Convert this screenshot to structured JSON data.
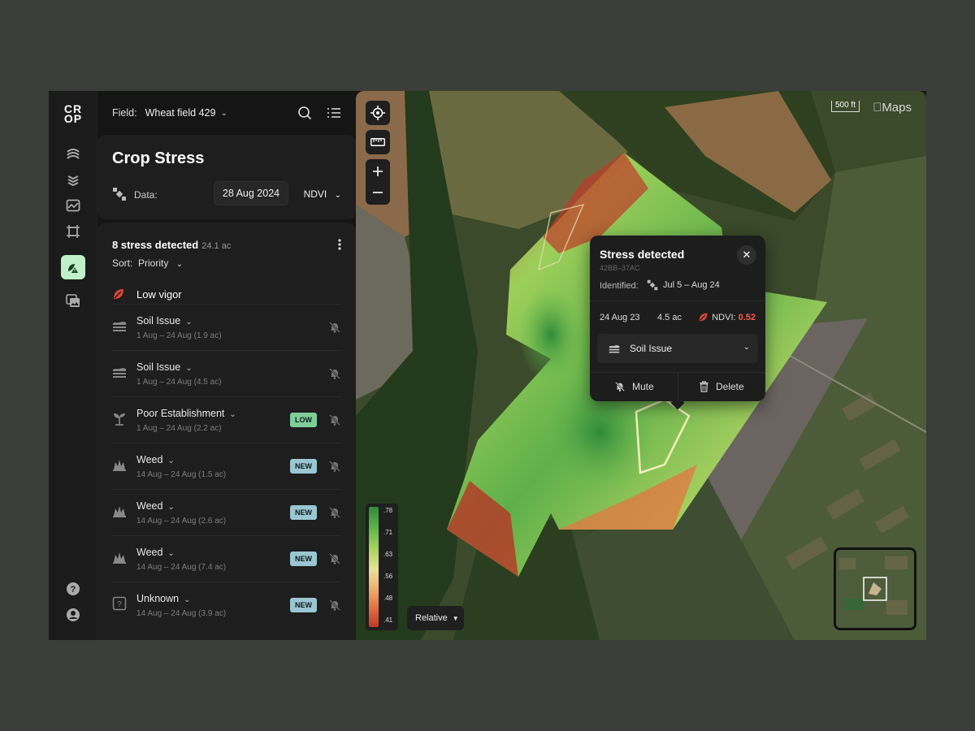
{
  "brand": {
    "logo_line1": "CR",
    "logo_line2": "OP"
  },
  "topbar": {
    "field_label": "Field:",
    "field_value": "Wheat field 429"
  },
  "card": {
    "title": "Crop Stress",
    "data_label": "Data:",
    "date": "28 Aug 2024",
    "index": "NDVI"
  },
  "list": {
    "count_label": "8 stress detected",
    "acreage": "24.1 ac",
    "sort_label": "Sort:",
    "sort_value": "Priority",
    "selected_item": "Low vigor",
    "items": [
      {
        "title": "Soil Issue",
        "sub": "1 Aug – 24 Aug (1.9 ac)",
        "icon": "soil-icon",
        "badge": ""
      },
      {
        "title": "Soil Issue",
        "sub": "1 Aug – 24 Aug (4.5 ac)",
        "icon": "soil-icon",
        "badge": ""
      },
      {
        "title": "Poor Establishment",
        "sub": "1 Aug – 24 Aug (2.2 ac)",
        "icon": "sprout-icon",
        "badge": "LOW"
      },
      {
        "title": "Weed",
        "sub": "14 Aug – 24 Aug (1.5 ac)",
        "icon": "weed-icon",
        "badge": "NEW"
      },
      {
        "title": "Weed",
        "sub": "14 Aug – 24 Aug (2.6 ac)",
        "icon": "weed-icon",
        "badge": "NEW"
      },
      {
        "title": "Weed",
        "sub": "14 Aug – 24 Aug (7.4 ac)",
        "icon": "weed-icon",
        "badge": "NEW"
      },
      {
        "title": "Unknown",
        "sub": "14 Aug – 24 Aug (3.9 ac)",
        "icon": "unknown-icon",
        "badge": "NEW"
      }
    ]
  },
  "map": {
    "scale_label": "500 ft",
    "provider": "Maps",
    "legend_ticks": [
      ".78",
      ".71",
      ".63",
      ".56",
      ".48",
      ".41"
    ],
    "mode": "Relative"
  },
  "popup": {
    "title": "Stress detected",
    "id": "42BB–37AC",
    "identified_label": "Identified:",
    "identified_range": "Jul 5 – Aug 24",
    "date": "24 Aug 23",
    "area": "4.5 ac",
    "ndvi_label": "NDVI:",
    "ndvi_value": "0.52",
    "type_value": "Soil Issue",
    "mute_label": "Mute",
    "delete_label": "Delete"
  },
  "colors": {
    "accent": "#bff0c8",
    "badge_low": "#7fce9a",
    "badge_new": "#9ac6d2",
    "ndvi_alert": "#ff5a4a"
  }
}
